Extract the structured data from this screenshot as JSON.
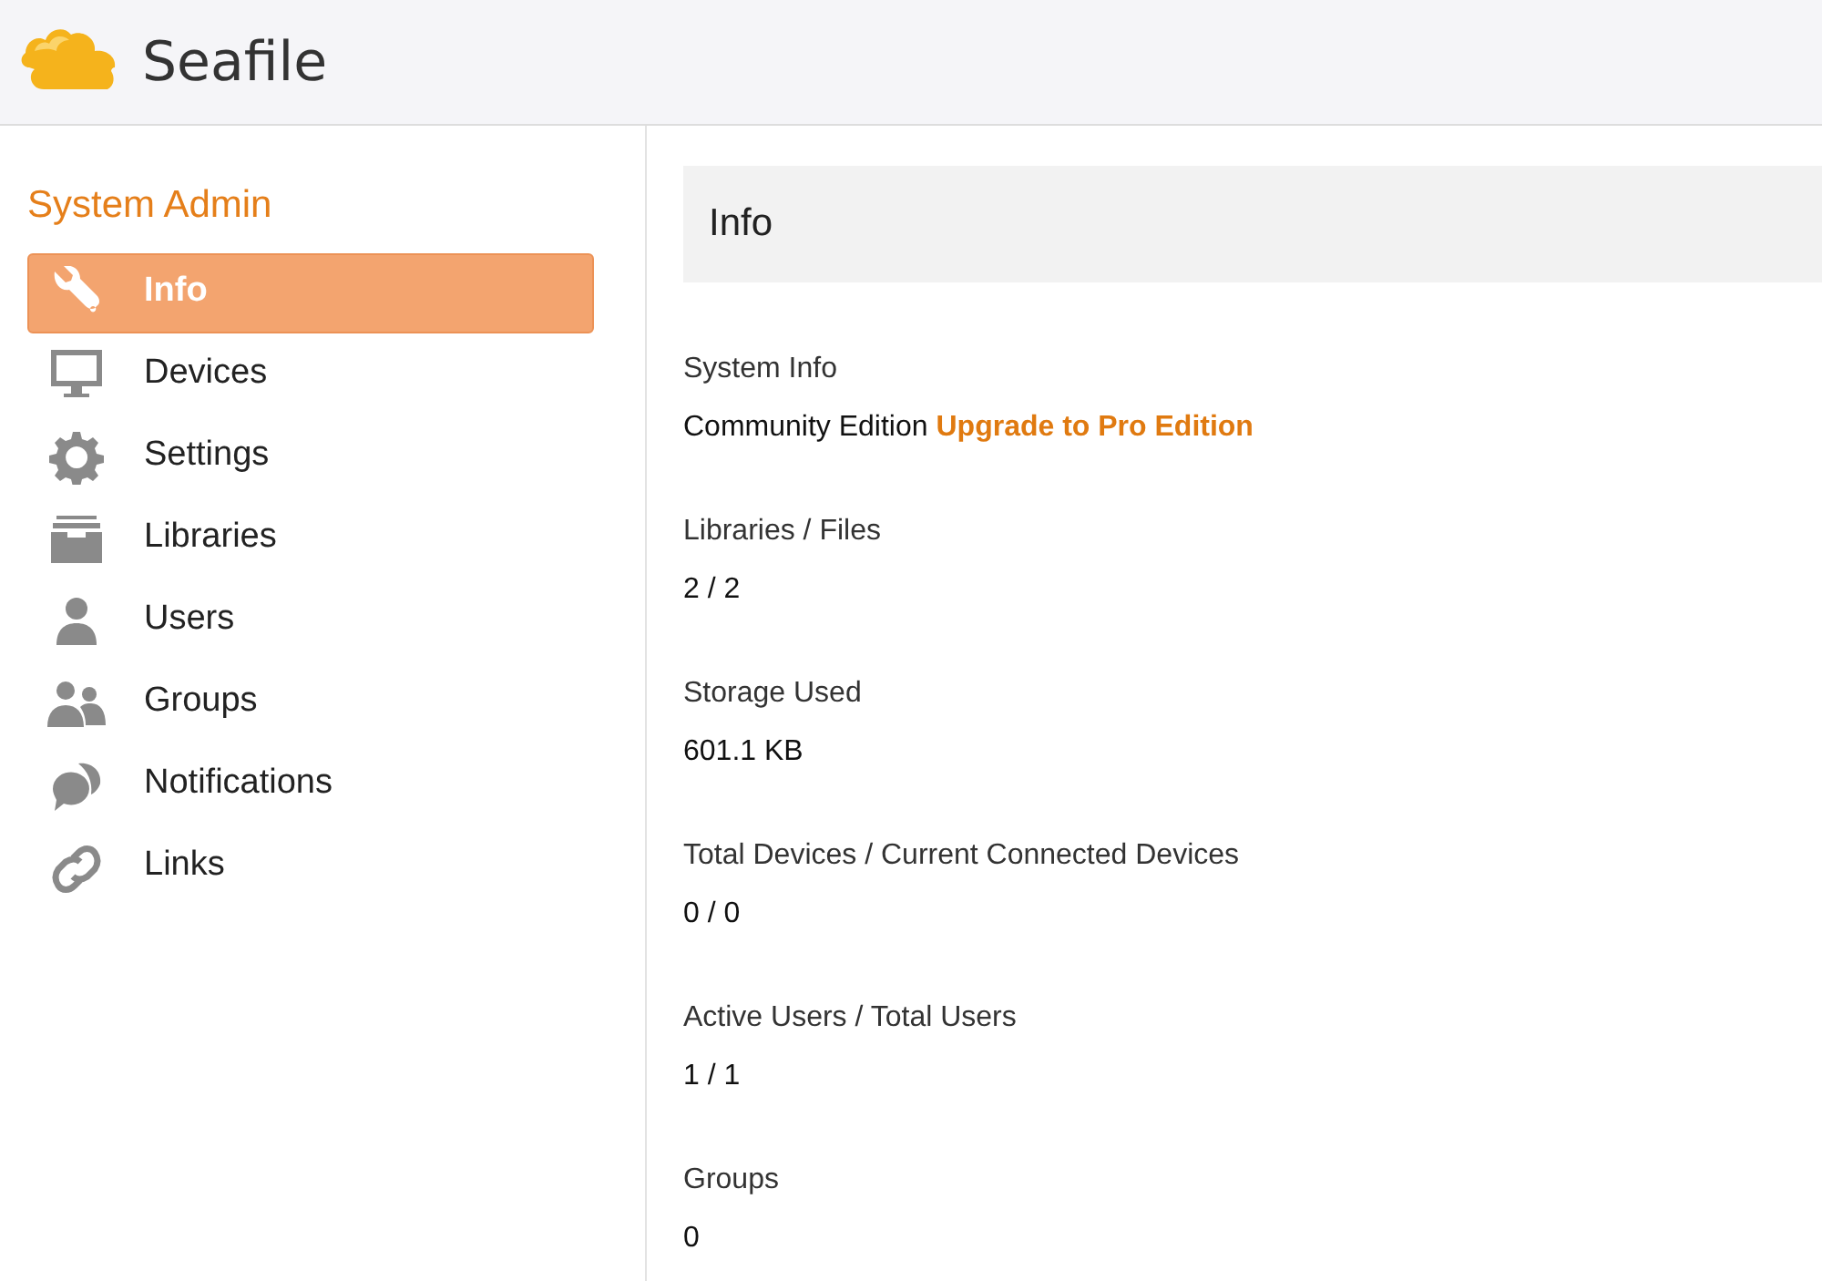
{
  "header": {
    "logo_text": "Seafile"
  },
  "sidebar": {
    "title": "System Admin",
    "items": [
      {
        "label": "Info",
        "selected": true
      },
      {
        "label": "Devices",
        "selected": false
      },
      {
        "label": "Settings",
        "selected": false
      },
      {
        "label": "Libraries",
        "selected": false
      },
      {
        "label": "Users",
        "selected": false
      },
      {
        "label": "Groups",
        "selected": false
      },
      {
        "label": "Notifications",
        "selected": false
      },
      {
        "label": "Links",
        "selected": false
      }
    ]
  },
  "main": {
    "heading": "Info",
    "sections": [
      {
        "label": "System Info",
        "value": "Community Edition",
        "link": "Upgrade to Pro Edition"
      },
      {
        "label": "Libraries / Files",
        "value": "2 / 2"
      },
      {
        "label": "Storage Used",
        "value": "601.1 KB"
      },
      {
        "label": "Total Devices / Current Connected Devices",
        "value": "0 / 0"
      },
      {
        "label": "Active Users / Total Users",
        "value": "1 / 1"
      },
      {
        "label": "Groups",
        "value": "0"
      }
    ]
  }
}
